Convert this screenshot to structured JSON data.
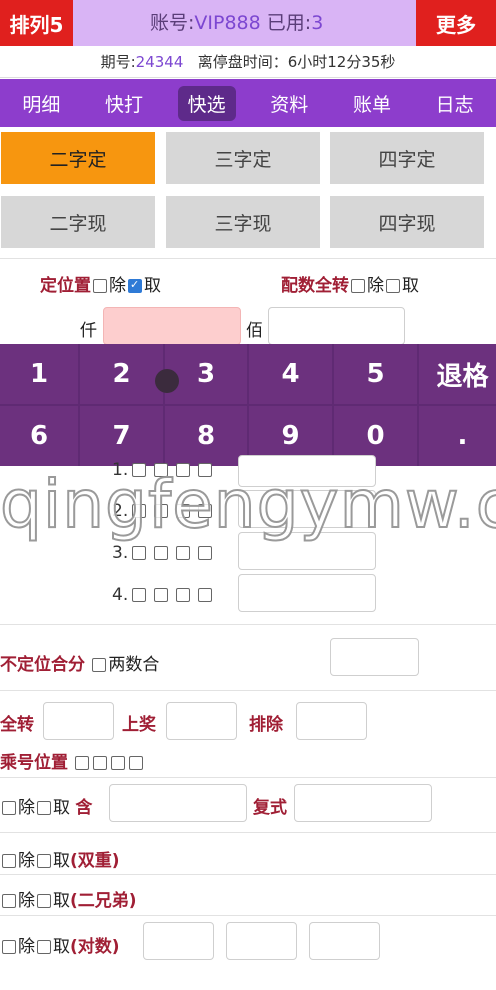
{
  "header": {
    "left_button": "排列5",
    "account_prefix": "账号:",
    "account_value": "VIP888",
    "used_prefix": "已用:",
    "used_value": "3",
    "right_button": "更多"
  },
  "period": {
    "label": "期号:",
    "value": "24344",
    "close_label": "离停盘时间：6小时12分35秒"
  },
  "nav": [
    "明细",
    "快打",
    "快选",
    "资料",
    "账单",
    "日志"
  ],
  "types": [
    "二字定",
    "三字定",
    "四字定",
    "二字现",
    "三字现",
    "四字现"
  ],
  "position_row": {
    "fixed_label": "定位置",
    "exclude": "除",
    "take": "取",
    "combo_label": "配数全转"
  },
  "digits": {
    "qian": "仟",
    "bai": "佰"
  },
  "keypad": [
    "1",
    "2",
    "3",
    "4",
    "5",
    "退格",
    "6",
    "7",
    "8",
    "9",
    "0",
    "."
  ],
  "watermark": "qingfengymw.c",
  "rows": [
    "1.",
    "2.",
    "3.",
    "4."
  ],
  "nonfixed": {
    "label": "不定位合分",
    "two_sum": "两数合"
  },
  "full_turn": {
    "label": "全转",
    "upper": "上奖",
    "exclude": "排除"
  },
  "multiply": {
    "label": "乘号位置"
  },
  "contain": {
    "exclude": "除",
    "take": "取",
    "contain_label": "含",
    "compound_label": "复式"
  },
  "double": {
    "exclude": "除",
    "take": "取",
    "label": "(双重)"
  },
  "brothers": {
    "exclude": "除",
    "take": "取",
    "label": "(二兄弟)"
  },
  "pairs": {
    "exclude": "除",
    "take": "取",
    "label": "(对数)"
  }
}
